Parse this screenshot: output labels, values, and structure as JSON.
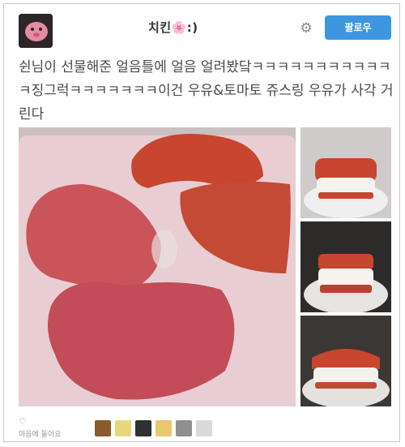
{
  "header": {
    "username": "치킨🌸:)",
    "follow_label": "팔로우",
    "gear_icon": "gear-icon"
  },
  "tweet": {
    "text": "쉰님이 선물해준 얼음틀에 얼음 얼려봤닼ㅋㅋㅋㅋㅋㅋㅋㅋㅋㅋㅋㅋ징그럭ㅋㅋㅋㅋㅋㅋㅋ이건 우유&토마토 쥬스링 우유가 사각 거린다"
  },
  "footer": {
    "like_icon": "heart-icon",
    "like_label": "마음에 들어요"
  },
  "colors": {
    "accent": "#3f96e0",
    "tomato": "#c8452f",
    "mold": "#e6c9cf"
  }
}
